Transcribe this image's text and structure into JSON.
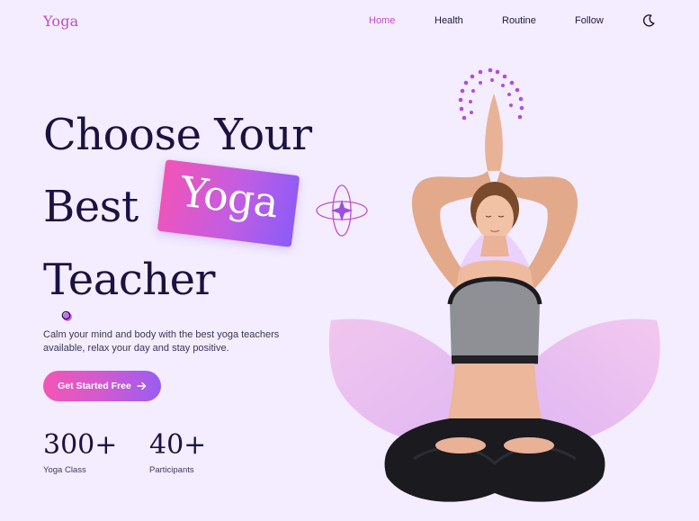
{
  "header": {
    "logo": "Yoga",
    "nav": [
      {
        "label": "Home",
        "active": true
      },
      {
        "label": "Health",
        "active": false
      },
      {
        "label": "Routine",
        "active": false
      },
      {
        "label": "Follow",
        "active": false
      }
    ],
    "theme_icon": "moon-icon"
  },
  "hero": {
    "headline_line1": "Choose Your",
    "headline_line2": "Best",
    "headline_badge": "Yoga",
    "headline_line3": "Teacher",
    "subtitle": "Calm your mind and body with the best yoga teachers available, relax your day and stay positive.",
    "cta_label": "Get Started Free",
    "cta_icon": "arrow-right-icon"
  },
  "stats": [
    {
      "value": "300+",
      "label": "Yoga Class"
    },
    {
      "value": "40+",
      "label": "Participants"
    }
  ],
  "colors": {
    "background": "#f3edff",
    "accent_pink": "#f254b6",
    "accent_purple": "#8a5cf7",
    "heading": "#1c1240",
    "nav_active": "#c24bc6"
  }
}
